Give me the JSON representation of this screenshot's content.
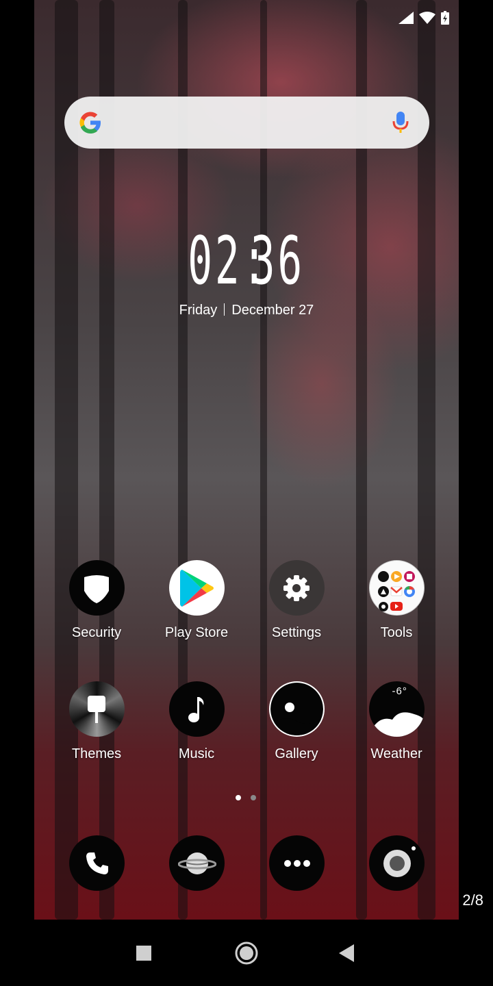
{
  "status_bar": {
    "icons": [
      "signal-icon",
      "wifi-icon",
      "battery-icon"
    ]
  },
  "search": {
    "placeholder": "",
    "icons": [
      "google-logo",
      "mic-icon"
    ]
  },
  "clock": {
    "hours": "02",
    "minutes": "36",
    "day": "Friday",
    "date": "December 27"
  },
  "apps": [
    {
      "label": "Security"
    },
    {
      "label": "Play Store"
    },
    {
      "label": "Settings"
    },
    {
      "label": "Tools"
    },
    {
      "label": "Themes"
    },
    {
      "label": "Music"
    },
    {
      "label": "Gallery"
    },
    {
      "label": "Weather"
    }
  ],
  "weather": {
    "temp": "-6°"
  },
  "page_indicator": {
    "active_page": 1,
    "total_dots": 2,
    "active_color": "#ffffff",
    "inactive_color": "#8a8a8a"
  },
  "dock": {
    "items": [
      "phone-icon",
      "browser-icon",
      "more-apps-icon",
      "camera-icon"
    ]
  },
  "screenshot_counter": "2/8",
  "navbar": {
    "buttons": [
      "recents-button",
      "home-button",
      "back-button"
    ]
  }
}
